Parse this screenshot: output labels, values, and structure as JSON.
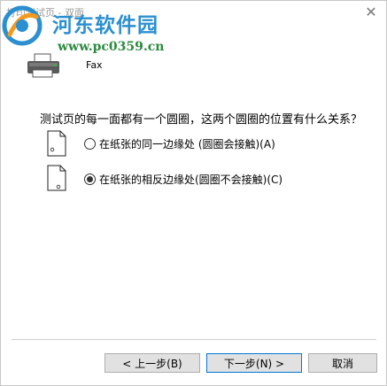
{
  "window": {
    "title": "打印测试页 - 双面"
  },
  "watermark": {
    "site_name": "河东软件园",
    "url": "www.pc0359.cn"
  },
  "printer": {
    "name": "Fax"
  },
  "question": "测试页的每一面都有一个圆圈，这两个圆圈的位置有什么关系？",
  "options": [
    {
      "label": "在纸张的同一边缘处 (圆圈会接触)(A)",
      "checked": false
    },
    {
      "label": "在纸张的相反边缘处(圆圈不会接触)(C)",
      "checked": true
    }
  ],
  "buttons": {
    "back": "< 上一步(B)",
    "next": "下一步(N) >",
    "cancel": "取消"
  },
  "colors": {
    "watermark_blue": "#2b8fd0",
    "watermark_green": "#2c8a3e",
    "focus_border": "#0078d7"
  }
}
